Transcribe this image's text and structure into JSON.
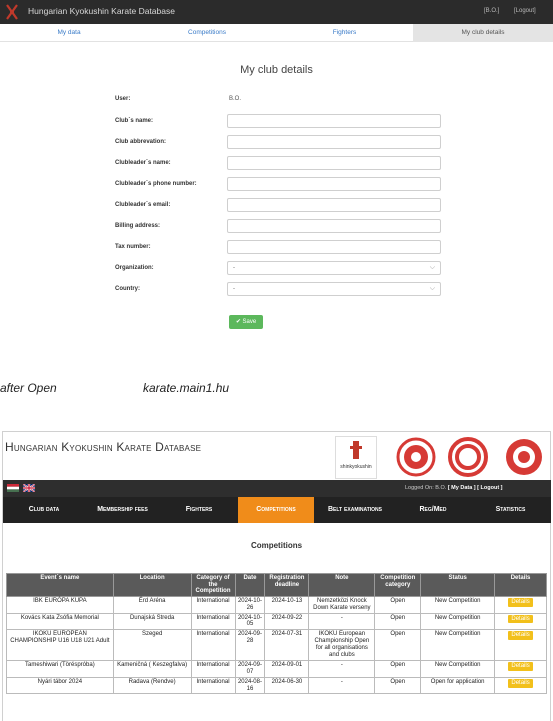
{
  "top": {
    "app_title": "Hungarian Kyokushin Karate Database",
    "user_tag": "[B.O.]",
    "logout": "[Logout]",
    "tabs": [
      "My data",
      "Competitions",
      "Fighters",
      "My club details"
    ],
    "active_tab": "My club details",
    "section_title": "My club details",
    "form": {
      "user_label": "User:",
      "user_value": "B.O.",
      "club_name": "Club´s name:",
      "club_abbr": "Club abbrevation:",
      "leader_name": "Clubleader´s name:",
      "leader_phone": "Clubleader´s phone number:",
      "leader_email": "Clubleader´s email:",
      "billing": "Billing address:",
      "tax": "Tax number:",
      "org": "Organization:",
      "org_value": "-",
      "country": "Country:",
      "country_value": "-",
      "save": "✔ Save"
    }
  },
  "captions": {
    "left": "after Open",
    "right": "karate.main1.hu"
  },
  "bottom": {
    "db_title": "Hungarian Kyokushin Karate Database",
    "logo_text": "shinkyokushin",
    "logged_prefix": "Logged On: B.O.",
    "my_data_link": "[ My Data ]",
    "logout_link": "[ Logout ]",
    "nav": [
      "Club data",
      "Membership fees",
      "Fighters",
      "Competitions",
      "Belt examinations",
      "Reg/Med",
      "Statistics"
    ],
    "active_nav": "Competitions",
    "competitions_title": "Competitions",
    "headers": [
      "Event´s name",
      "Location",
      "Category of the Competition",
      "Date",
      "Registration deadline",
      "Note",
      "Competition category",
      "Status",
      "Details"
    ],
    "rows": [
      [
        "IBK EURÓPA KUPA",
        "Érd Aréna",
        "International",
        "2024-10-26",
        "2024-10-13",
        "Nemzetközi Knock Down Karate verseny",
        "Open",
        "New Competition",
        "Details"
      ],
      [
        "Kovács Kata Zsófia Memorial",
        "Dunajská Streda",
        "International",
        "2024-10-05",
        "2024-09-22",
        "-",
        "Open",
        "New Competition",
        "Details"
      ],
      [
        "IKOKU EUROPEAN CHAMPIONSHIP U16 U18 U21 Adult",
        "Szeged",
        "International",
        "2024-09-28",
        "2024-07-31",
        "IKOKU European Championship Open for all organisations and clubs",
        "Open",
        "New Competition",
        "Details"
      ],
      [
        "Tameshiwari (Töréspróba)",
        "Kameničná ( Keszegfalva)",
        "International",
        "2024-09-07",
        "2024-09-01",
        "-",
        "Open",
        "New Competition",
        "Details"
      ],
      [
        "Nyári tábor 2024",
        "Radava (Rendve)",
        "International",
        "2024-08-16",
        "2024-06-30",
        "-",
        "Open",
        "Open for application",
        "Details"
      ]
    ],
    "colors": {
      "nav_active": "#f08c1a",
      "details_button": "#f2c01b",
      "header_bg": "#5a5a5a"
    }
  }
}
